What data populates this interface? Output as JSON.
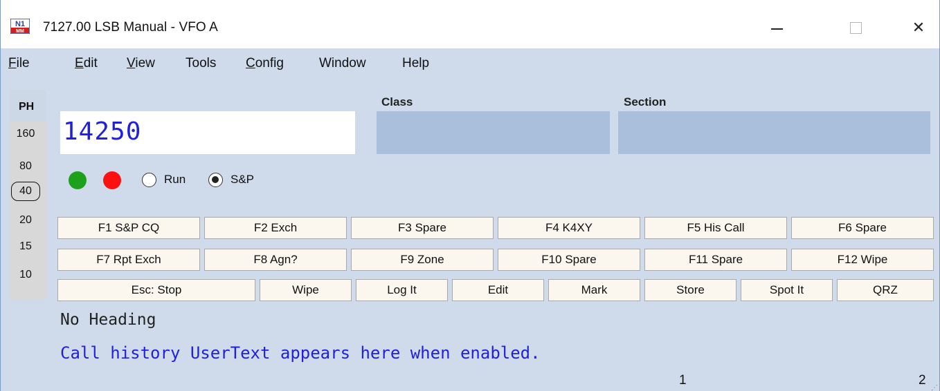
{
  "window": {
    "title": "7127.00 LSB Manual - VFO A",
    "logo_text_top": "N1",
    "logo_text_bottom": "MM",
    "minimize_icon": "minimize-icon",
    "maximize_icon": "maximize-icon",
    "close_icon": "close-icon",
    "close_glyph": "✕"
  },
  "menu": [
    {
      "label": "File",
      "key": "F",
      "rest": "ile"
    },
    {
      "label": "Edit",
      "key": "E",
      "rest": "dit"
    },
    {
      "label": "View",
      "key": "V",
      "rest": "iew"
    },
    {
      "label": "Tools",
      "key": "",
      "rest": "Tools"
    },
    {
      "label": "Config",
      "key": "C",
      "rest": "onfig"
    },
    {
      "label": "Window",
      "key": "",
      "rest": "Window"
    },
    {
      "label": "Help",
      "key": "",
      "rest": "Help"
    }
  ],
  "bands": {
    "mode": "PH",
    "items": [
      "160",
      "80",
      "40",
      "20",
      "15",
      "10"
    ],
    "selected": "40"
  },
  "entry": {
    "callsign_value": "14250",
    "class_label": "Class",
    "section_label": "Section",
    "class_value": "",
    "section_value": ""
  },
  "status": {
    "green_color": "#1da11d",
    "red_color": "#ff1010",
    "run_label": "Run",
    "sp_label": "S&P",
    "selected_mode": "S&P"
  },
  "function_keys": {
    "row1": [
      "F1 S&P CQ",
      "F2 Exch",
      "F3 Spare",
      "F4 K4XY",
      "F5 His Call",
      "F6 Spare"
    ],
    "row2": [
      "F7 Rpt Exch",
      "F8 Agn?",
      "F9 Zone",
      "F10 Spare",
      "F11 Spare",
      "F12 Wipe"
    ],
    "row3": [
      "Esc: Stop",
      "Wipe",
      "Log It",
      "Edit",
      "Mark",
      "Store",
      "Spot It",
      "QRZ"
    ]
  },
  "heading_text": "No Heading",
  "usertext": "Call history UserText appears here when enabled.",
  "statusbar": {
    "left_num": "1",
    "right_num": "2"
  }
}
